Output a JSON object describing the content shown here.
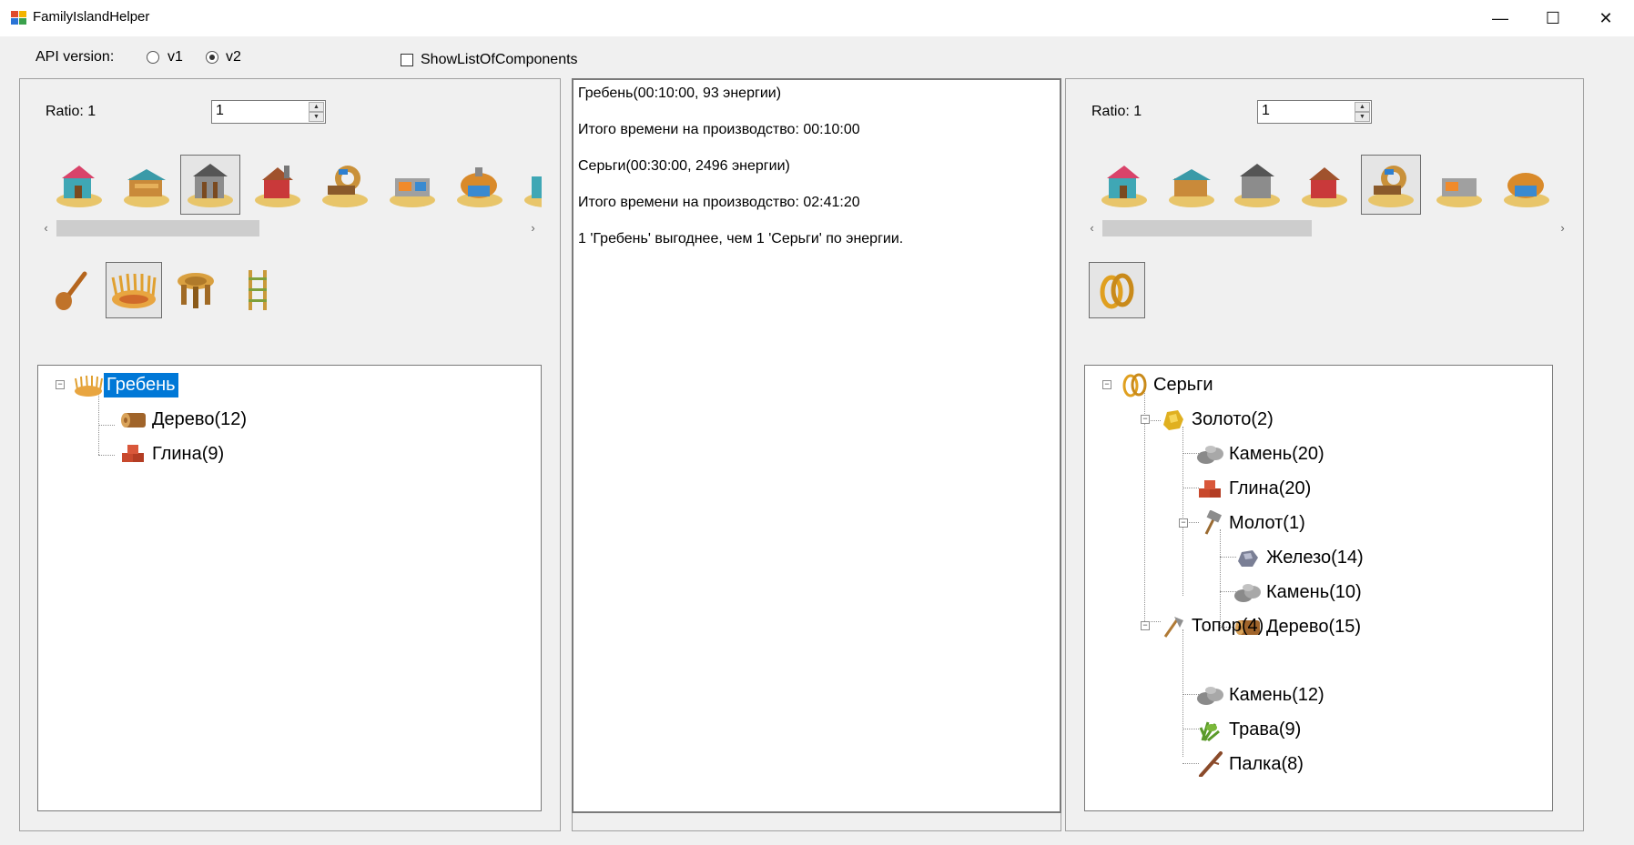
{
  "window": {
    "title": "FamilyIslandHelper",
    "app_icon": "app-icon",
    "buttons": [
      "minimize-icon",
      "maximize-icon",
      "close-icon"
    ],
    "minimize": "—",
    "maximize": "☐",
    "close": "✕"
  },
  "toolbar": {
    "api_label": "API version:",
    "api_options": [
      {
        "label": "v1",
        "checked": false
      },
      {
        "label": "v2",
        "checked": true
      }
    ],
    "show_list_label": "ShowListOfComponents",
    "show_list_checked": false
  },
  "left": {
    "ratio_label": "Ratio: 1",
    "ratio_value": "1",
    "buildings_selected_index": 2,
    "items_selected_index": 1,
    "tree": [
      {
        "label": "Гребень",
        "level": 0,
        "icon": "comb-icon",
        "selected": true
      },
      {
        "label": "Дерево(12)",
        "level": 1,
        "icon": "log-icon"
      },
      {
        "label": "Глина(9)",
        "level": 1,
        "icon": "clay-icon"
      }
    ]
  },
  "middle": {
    "lines": [
      "Гребень(00:10:00, 93 энергии)",
      "Итого времени на производство: 00:10:00",
      "Серьги(00:30:00, 2496 энергии)",
      "Итого времени на производство: 02:41:20",
      "1 'Гребень' выгоднее, чем 1 'Серьги' по энергии."
    ]
  },
  "right": {
    "ratio_label": "Ratio: 1",
    "ratio_value": "1",
    "buildings_selected_index": 4,
    "items_selected_index": 0,
    "tree": [
      {
        "label": "Серьги",
        "level": 0,
        "icon": "earrings-icon"
      },
      {
        "label": "Золото(2)",
        "level": 1,
        "icon": "gold-icon"
      },
      {
        "label": "Камень(20)",
        "level": 2,
        "icon": "stone-icon"
      },
      {
        "label": "Глина(20)",
        "level": 2,
        "icon": "clay-icon"
      },
      {
        "label": "Молот(1)",
        "level": 2,
        "icon": "hammer-icon"
      },
      {
        "label": "Железо(14)",
        "level": 3,
        "icon": "iron-icon"
      },
      {
        "label": "Камень(10)",
        "level": 3,
        "icon": "stone-icon"
      },
      {
        "label": "Дерево(15)",
        "level": 3,
        "icon": "log-icon"
      },
      {
        "label": "Топор(4)",
        "level": 1,
        "icon": "axe-icon"
      },
      {
        "label": "Камень(12)",
        "level": 2,
        "icon": "stone-icon"
      },
      {
        "label": "Трава(9)",
        "level": 2,
        "icon": "grass-icon"
      },
      {
        "label": "Палка(8)",
        "level": 2,
        "icon": "stick-icon"
      }
    ]
  },
  "building_icons": [
    "workshop-building-icon",
    "carpenter-building-icon",
    "mine-building-icon",
    "forge-building-icon",
    "weaving-building-icon",
    "smelter-building-icon",
    "kiln-building-icon"
  ],
  "left_item_icons": [
    "spoon-icon",
    "comb-icon",
    "stool-icon",
    "ladder-icon"
  ],
  "right_item_icons": [
    "earrings-icon"
  ],
  "colors": {
    "selection": "#0078d7",
    "window_bg": "#f0f0f0"
  }
}
